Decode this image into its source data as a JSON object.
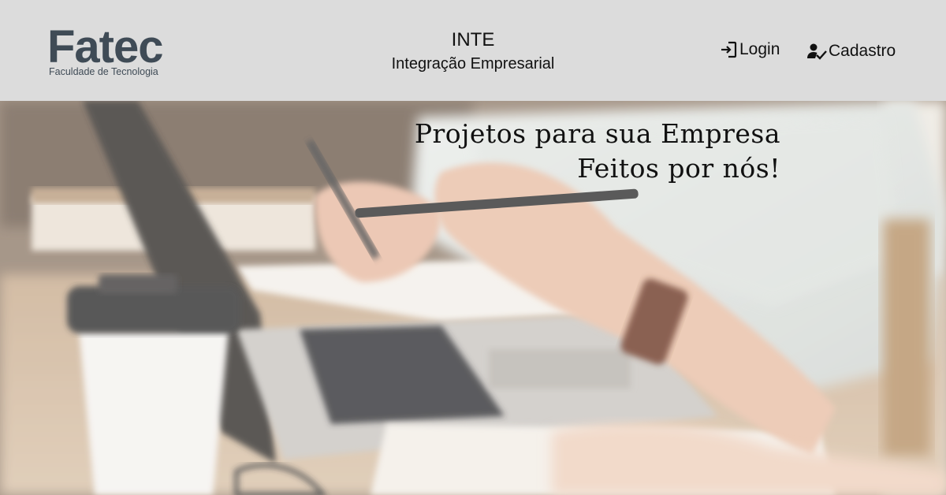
{
  "header": {
    "logo": {
      "wordmark": "Fatec",
      "tagline": "Faculdade de Tecnologia"
    },
    "brand": {
      "title": "INTE",
      "subtitle": "Integração Empresarial"
    },
    "nav": {
      "login": {
        "label": "Login",
        "icon": "login-icon"
      },
      "signup": {
        "label": "Cadastro",
        "icon": "user-check-icon"
      }
    }
  },
  "hero": {
    "headline_line1": "Projetos para sua Empresa",
    "headline_line2": "Feitos por nós!",
    "image": "blurred photo of people working at a desk with a laptop, coffee cup and notebook"
  },
  "colors": {
    "header_bg": "#dcdcdc",
    "logo_color": "#3f4b56",
    "text": "#111111"
  }
}
